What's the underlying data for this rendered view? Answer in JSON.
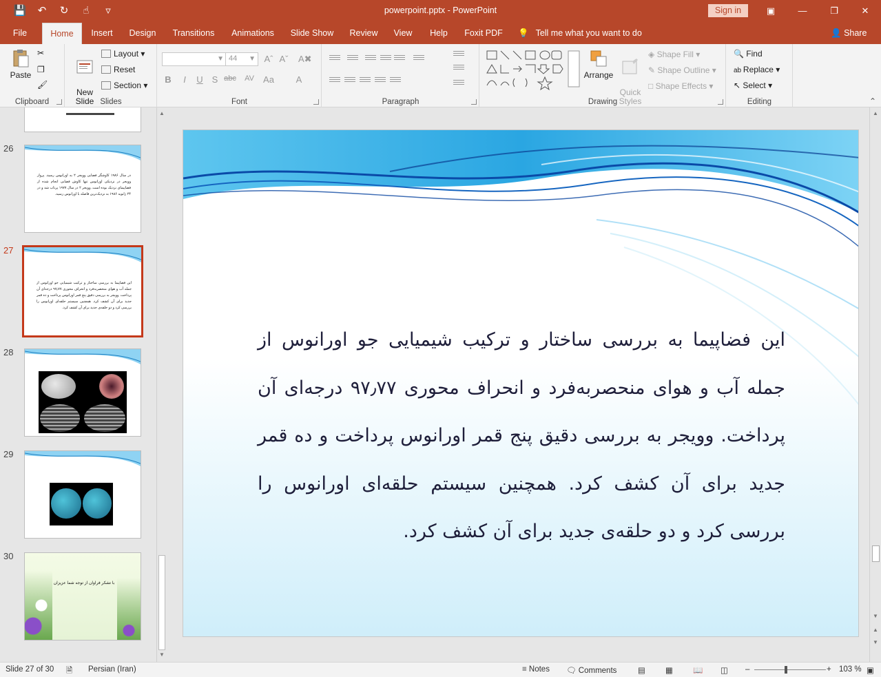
{
  "titlebar": {
    "title": "powerpoint.pptx  -  PowerPoint",
    "signin": "Sign in",
    "qat_icons": [
      "save-icon",
      "undo-icon",
      "redo-icon",
      "touch-mode-icon",
      "customize-icon"
    ]
  },
  "tabs": [
    {
      "label": "File"
    },
    {
      "label": "Home"
    },
    {
      "label": "Insert"
    },
    {
      "label": "Design"
    },
    {
      "label": "Transitions"
    },
    {
      "label": "Animations"
    },
    {
      "label": "Slide Show"
    },
    {
      "label": "Review"
    },
    {
      "label": "View"
    },
    {
      "label": "Help"
    },
    {
      "label": "Foxit PDF"
    }
  ],
  "tellme": "Tell me what you want to do",
  "share": "Share",
  "ribbon": {
    "clipboard": {
      "label": "Clipboard",
      "paste": "Paste"
    },
    "slides": {
      "label": "Slides",
      "new_slide": "New\nSlide",
      "layout": "Layout",
      "reset": "Reset",
      "section": "Section"
    },
    "font": {
      "label": "Font",
      "size": "44"
    },
    "paragraph": {
      "label": "Paragraph"
    },
    "drawing": {
      "label": "Drawing",
      "arrange": "Arrange",
      "quick_styles": "Quick\nStyles",
      "shape_fill": "Shape Fill",
      "shape_outline": "Shape Outline",
      "shape_effects": "Shape Effects"
    },
    "editing": {
      "label": "Editing",
      "find": "Find",
      "replace": "Replace",
      "select": "Select"
    }
  },
  "thumbnails": [
    {
      "number": "26",
      "text": "در سال ۱۹۸۶ کاوشگر فضایی وویجر ۲ به اورانوس رسید. پرواز وویجر در نزدیکی اورانوس تنها کاوش فضایی انجام شده از فضاپیمای نزدیک بوده است. وویجر ۲ در سال ۱۹۷۷ پرتاب شد و در ۲۴ ژانویه ۱۹۸۶ به نزدیک‌ترین فاصله با اورانوس رسید."
    },
    {
      "number": "27",
      "text": "این فضاپیما به بررسی ساختار و ترکیب شیمیایی جو اورانوس از جمله آب و هوای منحصربه‌فرد و انحراف محوری ۹۷٫۷۷ درجه‌ای آن پرداخت. وویجر به بررسی دقیق پنج قمر اورانوس پرداخت و ده قمر جدید برای آن کشف کرد. همچنین سیستم حلقه‌ای اورانوس را بررسی کرد و دو حلقه‌ی جدید برای آن کشف کرد."
    },
    {
      "number": "28",
      "text": ""
    },
    {
      "number": "29",
      "text": ""
    },
    {
      "number": "30",
      "text": "با تشکر فراوان از توجه شما عزیزان"
    }
  ],
  "slide": {
    "body": "این فضاپیما به بررسی ساختار و ترکیب شیمیایی جو اورانوس از جمله آب و هوای منحصربه‌فرد و انحراف محوری ۹۷٫۷۷ درجه‌ای آن پرداخت. وویجر به بررسی دقیق پنج قمر اورانوس پرداخت و ده قمر جدید برای آن کشف کرد. همچنین سیستم حلقه‌ای اورانوس را بررسی کرد و دو حلقه‌ی جدید برای آن کشف کرد."
  },
  "statusbar": {
    "slide_info": "Slide 27 of 30",
    "language": "Persian (Iran)",
    "notes": "Notes",
    "comments": "Comments",
    "zoom": "103 %"
  },
  "colors": {
    "accent": "#b7472a",
    "selected_thumb": "#c4391a",
    "wave_blue": "#1a9ad6"
  }
}
